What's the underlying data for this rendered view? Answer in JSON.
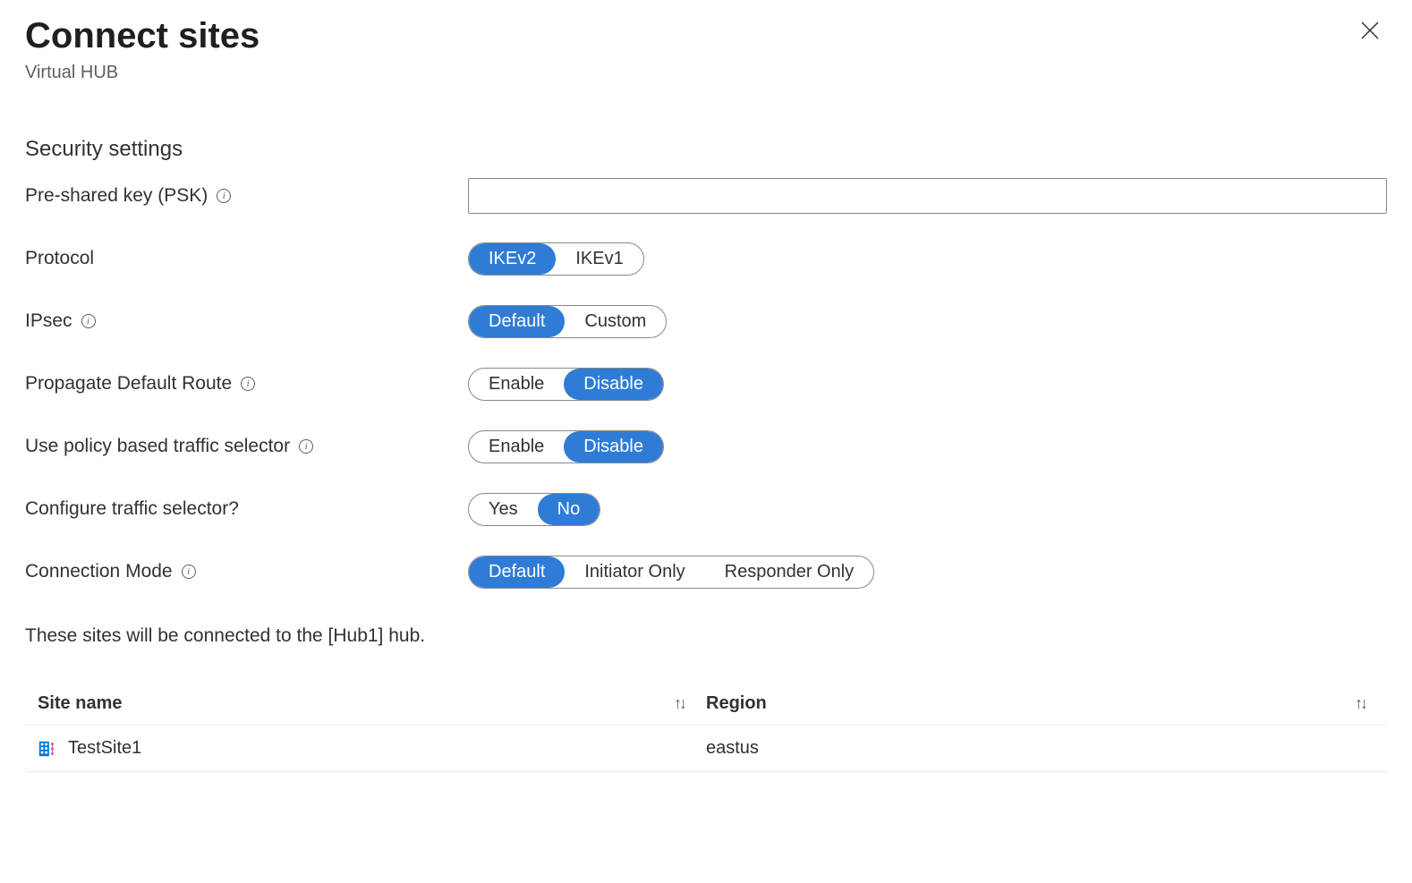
{
  "header": {
    "title": "Connect sites",
    "subtitle": "Virtual HUB"
  },
  "section_title": "Security settings",
  "fields": {
    "psk": {
      "label": "Pre-shared key (PSK)",
      "value": "",
      "has_info": true
    },
    "protocol": {
      "label": "Protocol",
      "options": [
        "IKEv2",
        "IKEv1"
      ],
      "selected": "IKEv2",
      "has_info": false
    },
    "ipsec": {
      "label": "IPsec",
      "options": [
        "Default",
        "Custom"
      ],
      "selected": "Default",
      "has_info": true
    },
    "propagate_default_route": {
      "label": "Propagate Default Route",
      "options": [
        "Enable",
        "Disable"
      ],
      "selected": "Disable",
      "has_info": true
    },
    "use_policy_based": {
      "label": "Use policy based traffic selector",
      "options": [
        "Enable",
        "Disable"
      ],
      "selected": "Disable",
      "has_info": true
    },
    "configure_traffic_selector": {
      "label": "Configure traffic selector?",
      "options": [
        "Yes",
        "No"
      ],
      "selected": "No",
      "has_info": false
    },
    "connection_mode": {
      "label": "Connection Mode",
      "options": [
        "Default",
        "Initiator Only",
        "Responder Only"
      ],
      "selected": "Default",
      "has_info": true
    }
  },
  "description": "These sites will be connected to the [Hub1] hub.",
  "table": {
    "columns": {
      "site_name": "Site name",
      "region": "Region"
    },
    "rows": [
      {
        "site_name": "TestSite1",
        "region": "eastus"
      }
    ]
  }
}
